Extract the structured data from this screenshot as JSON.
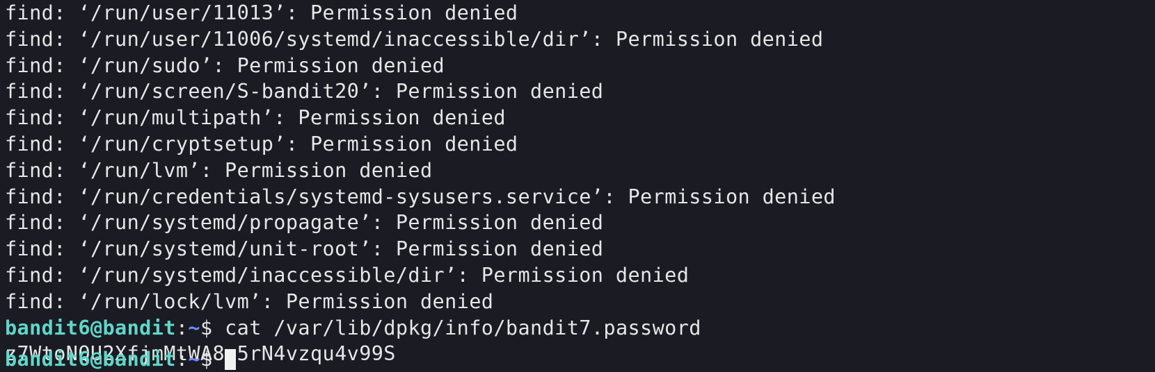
{
  "terminal": {
    "output_lines": [
      "find: ‘/run/user/11013’: Permission denied",
      "find: ‘/run/user/11006/systemd/inaccessible/dir’: Permission denied",
      "find: ‘/run/sudo’: Permission denied",
      "find: ‘/run/screen/S-bandit20’: Permission denied",
      "find: ‘/run/multipath’: Permission denied",
      "find: ‘/run/cryptsetup’: Permission denied",
      "find: ‘/run/lvm’: Permission denied",
      "find: ‘/run/credentials/systemd-sysusers.service’: Permission denied",
      "find: ‘/run/systemd/propagate’: Permission denied",
      "find: ‘/run/systemd/unit-root’: Permission denied",
      "find: ‘/run/systemd/inaccessible/dir’: Permission denied",
      "find: ‘/run/lock/lvm’: Permission denied"
    ],
    "prompt": {
      "user_host": "bandit6@bandit",
      "separator": ":",
      "path": "~",
      "symbol": "$",
      "command": " cat /var/lib/dpkg/info/bandit7.password"
    },
    "command_output": "z7WtoNQU2XfjmMtWA8u5rN4vzqu4v99S",
    "next_prompt": {
      "user_host": "bandit6@bandit",
      "separator": ":",
      "path": "~",
      "symbol": "$"
    },
    "colors": {
      "background": "#1b1b24",
      "text": "#e6e6e6",
      "user_host": "#5fd7c8",
      "path": "#6b8cff"
    }
  }
}
